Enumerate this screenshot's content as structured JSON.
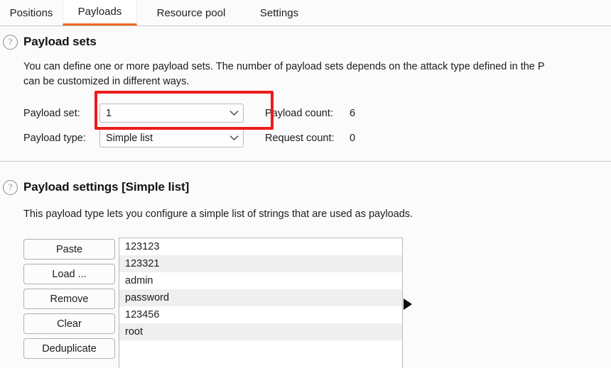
{
  "tabs": [
    {
      "label": "Positions",
      "active": false
    },
    {
      "label": "Payloads",
      "active": true
    },
    {
      "label": "Resource pool",
      "active": false
    },
    {
      "label": "Settings",
      "active": false
    }
  ],
  "accent_color": "#f26722",
  "annotation_color": "#ee1b1b",
  "payload_sets": {
    "help_icon": "question-mark-icon",
    "title": "Payload sets",
    "description_line1": "You can define one or more payload sets. The number of payload sets depends on the attack type defined in the P",
    "description_line2": "can be customized in different ways.",
    "payload_set_label": "Payload set:",
    "payload_set_value": "1",
    "payload_type_label": "Payload type:",
    "payload_type_value": "Simple list",
    "payload_count_label": "Payload count:",
    "payload_count_value": "6",
    "request_count_label": "Request count:",
    "request_count_value": "0",
    "dropdown_icon": "chevron-down-icon"
  },
  "payload_settings": {
    "help_icon": "question-mark-icon",
    "title": "Payload settings [Simple list]",
    "description": "This payload type lets you configure a simple list of strings that are used as payloads.",
    "buttons": [
      {
        "label": "Paste"
      },
      {
        "label": "Load ..."
      },
      {
        "label": "Remove"
      },
      {
        "label": "Clear"
      },
      {
        "label": "Deduplicate"
      }
    ],
    "payload_list": [
      "123123",
      "123321",
      "admin",
      "password",
      "123456",
      "root"
    ],
    "marker_icon": "triangle-right-icon"
  }
}
